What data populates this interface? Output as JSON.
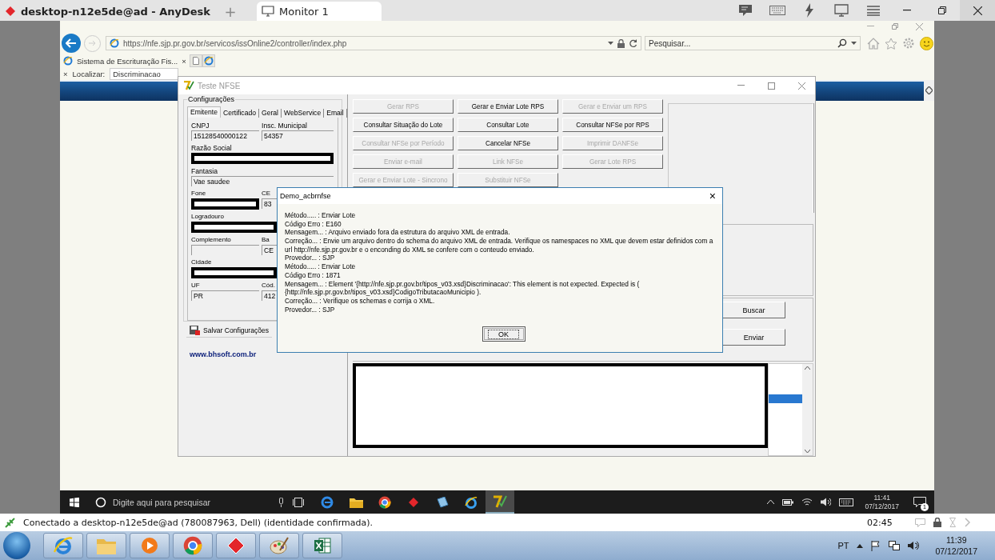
{
  "anydesk": {
    "tabs": [
      {
        "label": "desktop-n12e5de@ad - AnyDesk",
        "selected": false
      },
      {
        "label": "Monitor 1",
        "selected": true
      }
    ],
    "new_tab": "+"
  },
  "browser": {
    "address": "https://nfe.sjp.pr.gov.br/servicos/issOnline2/controller/index.php",
    "search": {
      "placeholder": "Pesquisar..."
    },
    "tab": {
      "label": "Sistema de Escrituração Fis...",
      "close": "×"
    },
    "find_bar": {
      "close": "×",
      "label": "Localizar:",
      "value": "Discriminacao"
    }
  },
  "app_window": {
    "title": "Teste NFSE",
    "settings": {
      "title": "Configurações",
      "tabs": [
        {
          "label": "Emitente",
          "selected": true
        },
        {
          "label": "Certificado",
          "selected": false
        },
        {
          "label": "Geral",
          "selected": false
        },
        {
          "label": "WebService",
          "selected": false
        },
        {
          "label": "Email",
          "selected": false
        }
      ],
      "field_rows": [
        [
          {
            "label": "CNPJ",
            "value": "15128540000122",
            "redacted": false
          },
          {
            "label": "Insc. Municipal",
            "value": "54357",
            "redacted": false
          }
        ],
        [
          {
            "label": "Razão Social",
            "redacted": true
          }
        ],
        [
          {
            "label": "Fantasia",
            "value": "Vae saudee",
            "redacted": false
          }
        ],
        [
          {
            "label": "Fone",
            "redacted": true
          },
          {
            "label": "CE",
            "value": "83",
            "redacted": false
          }
        ],
        [
          {
            "label": "Logradouro",
            "redacted": true
          }
        ],
        [
          {
            "label": "Complemento",
            "redacted": false
          },
          {
            "label": "Ba",
            "value": "CE",
            "redacted": false
          }
        ],
        [
          {
            "label": "Cidade",
            "redacted": true
          }
        ],
        [
          {
            "label": "UF",
            "value": "PR",
            "redacted": false
          },
          {
            "label": "Cód.",
            "value": "412",
            "redacted": false
          }
        ]
      ],
      "save_button": "Salvar Configurações",
      "link": "www.bhsoft.com.br"
    },
    "actions": [
      {
        "label": "Gerar RPS",
        "disabled": true
      },
      {
        "label": "Gerar e Enviar Lote RPS",
        "disabled": false
      },
      {
        "label": "Gerar e Enviar um RPS",
        "disabled": true
      },
      {
        "label": "Consultar Situação do Lote",
        "disabled": false
      },
      {
        "label": "Consultar Lote",
        "disabled": false
      },
      {
        "label": "Consultar NFSe por RPS",
        "disabled": false
      },
      {
        "label": "Consultar NFSe por Período",
        "disabled": true
      },
      {
        "label": "Cancelar NFSe",
        "disabled": false
      },
      {
        "label": "Imprimir DANFSe",
        "disabled": true
      },
      {
        "label": "Enviar e-mail",
        "disabled": true
      },
      {
        "label": "Link NFSe",
        "disabled": true
      },
      {
        "label": "Gerar Lote RPS",
        "disabled": true
      },
      {
        "label": "Gerar e Enviar Lote - Sincrono",
        "disabled": true
      },
      {
        "label": "Substituir NFSe",
        "disabled": true
      }
    ],
    "buttons": [
      "Buscar",
      "Enviar"
    ]
  },
  "dialog": {
    "title": "Demo_acbrnfse",
    "close": "×",
    "lines": [
      "Método..... : Enviar Lote",
      "Código Erro : E160",
      "Mensagem... : Arquivo enviado fora da estrutura do arquivo XML de entrada.",
      "Correção... : Envie um arquivo dentro do schema do arquivo XML de entrada. Verifique os namespaces no XML que devem estar definidos com a",
      "url http://nfe.sjp.pr.gov.br e o enconding do XML se confere com o conteudo enviado.",
      "Provedor... : SJP",
      "Método..... : Enviar Lote",
      "Código Erro : 1871",
      "Mensagem... : Element '{http://nfe.sjp.pr.gov.br/tipos_v03.xsd}Discriminacao': This element is not expected. Expected is (",
      "{http://nfe.sjp.pr.gov.br/tipos_v03.xsd}CodigoTributacaoMunicipio ).",
      "Correção... : Verifique os schemas e corrija o XML.",
      "Provedor... : SJP"
    ],
    "ok": "OK"
  },
  "remote_taskbar": {
    "search_placeholder": "Digite aqui para pesquisar",
    "time": "11:41",
    "date": "07/12/2017",
    "notification_count": "1"
  },
  "status_bar": {
    "text": "Conectado a desktop-n12e5de@ad (780087963, Dell) (identidade confirmada).",
    "timer": "02:45"
  },
  "host_taskbar": {
    "language": "PT",
    "time": "11:39",
    "date": "07/12/2017"
  }
}
